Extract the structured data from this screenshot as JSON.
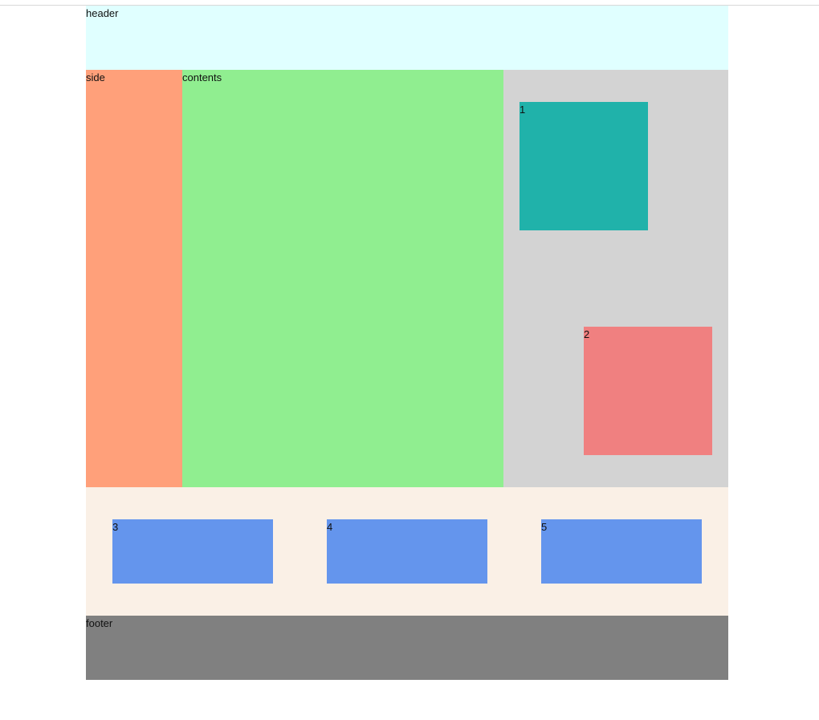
{
  "header": {
    "label": "header"
  },
  "side": {
    "label": "side"
  },
  "contents": {
    "label": "contents"
  },
  "panel": {
    "boxes": [
      {
        "label": "1"
      },
      {
        "label": "2"
      }
    ]
  },
  "row": {
    "boxes": [
      {
        "label": "3"
      },
      {
        "label": "4"
      },
      {
        "label": "5"
      }
    ]
  },
  "footer": {
    "label": "footer"
  },
  "colors": {
    "header": "#e0ffff",
    "side": "#ffa07a",
    "contents": "#90ee90",
    "panel": "#d3d3d3",
    "box_1": "#20b2aa",
    "box_2": "#f08080",
    "row": "#faf0e6",
    "row_boxes": "#6495ed",
    "footer": "#808080"
  }
}
